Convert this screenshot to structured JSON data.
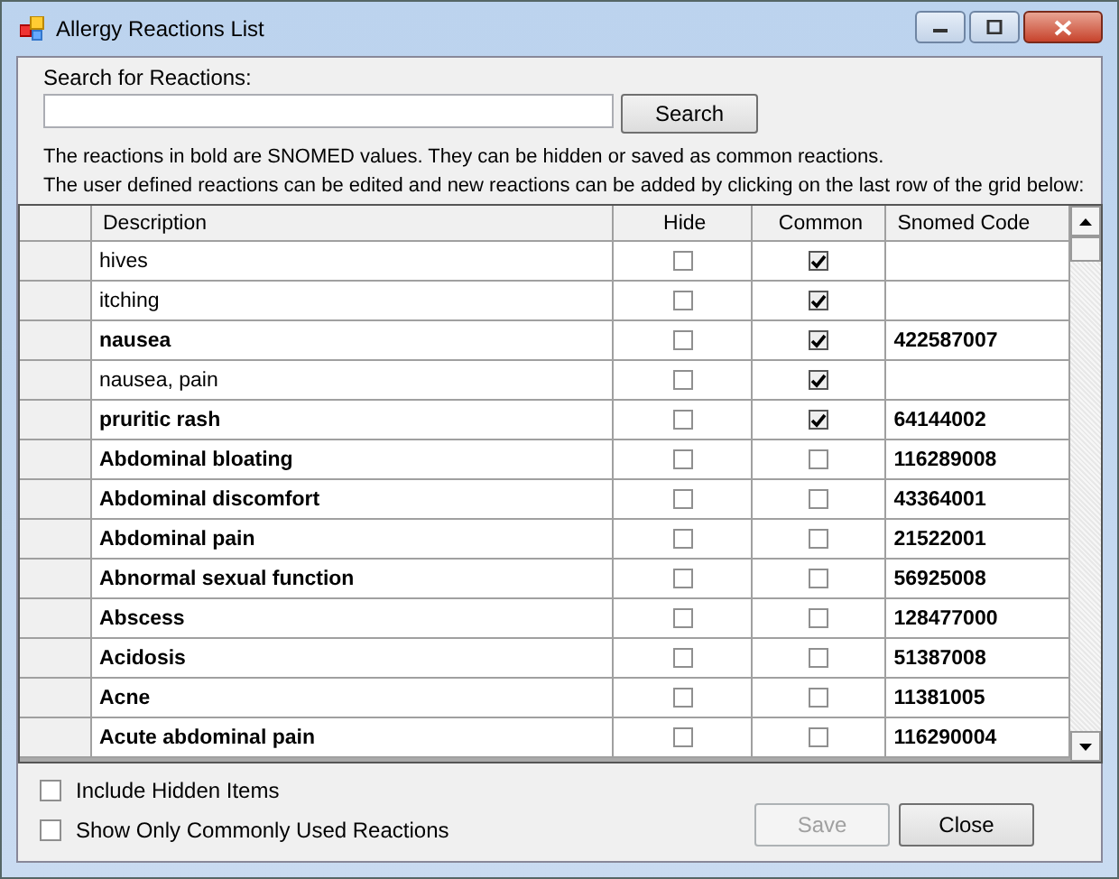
{
  "window": {
    "title": "Allergy Reactions List"
  },
  "search": {
    "label": "Search for Reactions:",
    "button": "Search"
  },
  "notes": [
    "The reactions in bold are SNOMED values. They can be hidden or saved as common reactions.",
    "The user defined reactions can be edited and new reactions can be added by clicking on the last row of the grid below:"
  ],
  "table": {
    "columns": [
      "Description",
      "Hide",
      "Common",
      "Snomed Code"
    ],
    "rows": [
      {
        "kind": "user",
        "description": "hives",
        "hide": false,
        "common": true,
        "code": ""
      },
      {
        "kind": "user",
        "description": "itching",
        "hide": false,
        "common": true,
        "code": ""
      },
      {
        "kind": "snomed",
        "description": "nausea",
        "hide": false,
        "common": true,
        "code": "422587007"
      },
      {
        "kind": "user",
        "description": "nausea, pain",
        "hide": false,
        "common": true,
        "code": ""
      },
      {
        "kind": "snomed",
        "description": "pruritic rash",
        "hide": false,
        "common": true,
        "code": "64144002"
      },
      {
        "kind": "snomed",
        "description": "Abdominal bloating",
        "hide": false,
        "common": false,
        "code": "116289008"
      },
      {
        "kind": "snomed",
        "description": "Abdominal discomfort",
        "hide": false,
        "common": false,
        "code": "43364001"
      },
      {
        "kind": "snomed",
        "description": "Abdominal pain",
        "hide": false,
        "common": false,
        "code": "21522001"
      },
      {
        "kind": "snomed",
        "description": "Abnormal sexual function",
        "hide": false,
        "common": false,
        "code": "56925008"
      },
      {
        "kind": "snomed",
        "description": "Abscess",
        "hide": false,
        "common": false,
        "code": "128477000"
      },
      {
        "kind": "snomed",
        "description": "Acidosis",
        "hide": false,
        "common": false,
        "code": "51387008"
      },
      {
        "kind": "snomed",
        "description": "Acne",
        "hide": false,
        "common": false,
        "code": "11381005"
      },
      {
        "kind": "snomed",
        "description": "Acute abdominal pain",
        "hide": false,
        "common": false,
        "code": "116290004"
      }
    ]
  },
  "options": [
    {
      "label": "Include Hidden Items",
      "checked": false
    },
    {
      "label": "Show Only Commonly Used Reactions",
      "checked": false
    }
  ],
  "buttons": [
    {
      "label": "Save",
      "disabled": true
    },
    {
      "label": "Close",
      "disabled": false
    }
  ]
}
